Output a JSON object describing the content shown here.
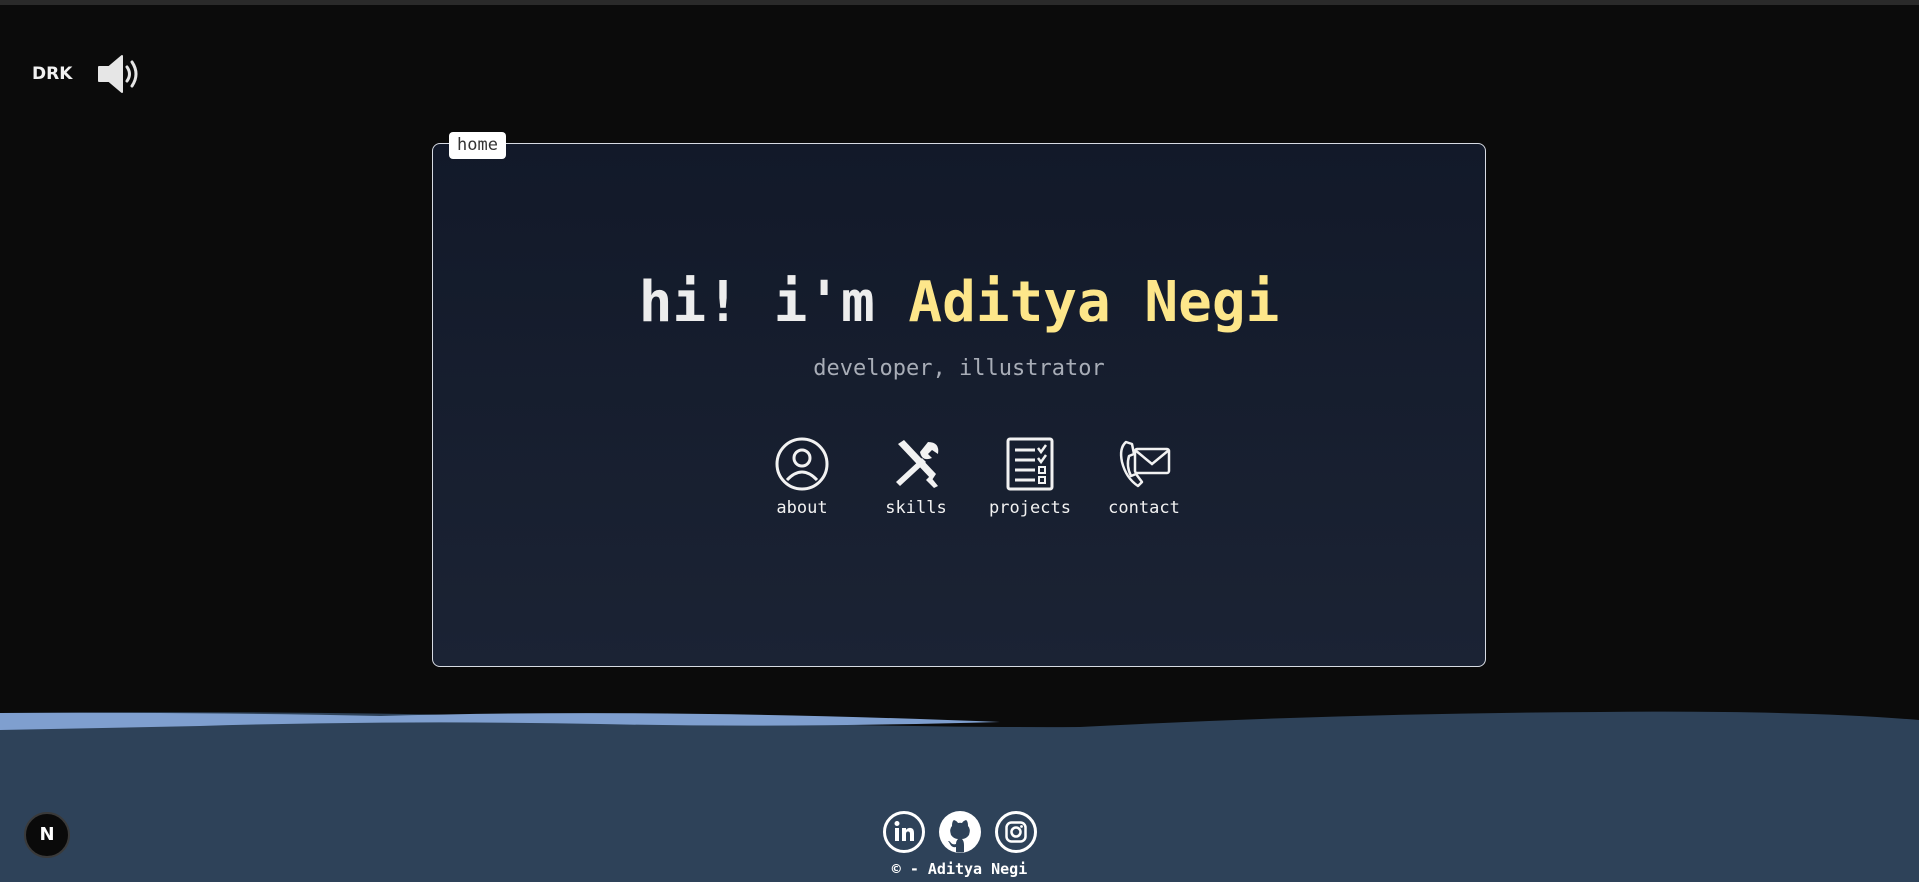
{
  "header": {
    "theme_toggle_label": "DRK",
    "sound_icon": "speaker-volume-icon"
  },
  "card": {
    "tab_label": "home",
    "greeting": "hi! i'm ",
    "name": "Aditya Negi",
    "subtitle": "developer, illustrator",
    "name_color": "#fde68a"
  },
  "nav": {
    "items": [
      {
        "label": "about",
        "icon": "user-circle-icon"
      },
      {
        "label": "skills",
        "icon": "tools-icon"
      },
      {
        "label": "projects",
        "icon": "checklist-icon"
      },
      {
        "label": "contact",
        "icon": "phone-mail-icon"
      }
    ]
  },
  "footer": {
    "socials": [
      {
        "icon": "linkedin-icon"
      },
      {
        "icon": "github-icon"
      },
      {
        "icon": "instagram-icon"
      }
    ],
    "copyright": "© - Aditya Negi",
    "wave_color": "#2e4259",
    "wave_highlight_color": "#7f9fcf"
  },
  "next_badge": {
    "label": "N"
  }
}
